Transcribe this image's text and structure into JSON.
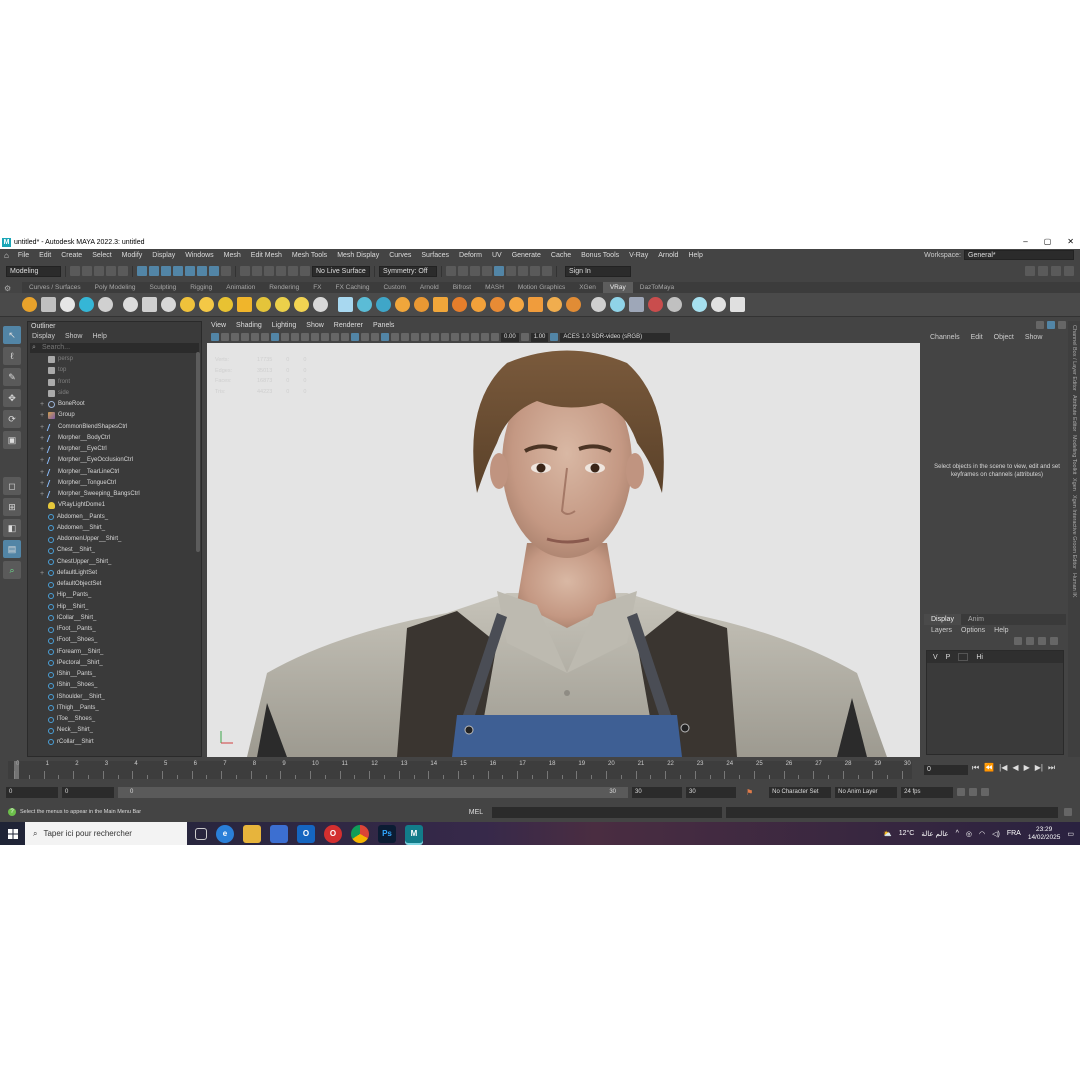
{
  "window": {
    "title": "untitled* - Autodesk MAYA 2022.3: untitled",
    "minimize": "–",
    "maximize": "▢",
    "close": "✕"
  },
  "menubar": {
    "items": [
      "File",
      "Edit",
      "Create",
      "Select",
      "Modify",
      "Display",
      "Windows",
      "Mesh",
      "Edit Mesh",
      "Mesh Tools",
      "Mesh Display",
      "Curves",
      "Surfaces",
      "Deform",
      "UV",
      "Generate",
      "Cache",
      "Bonus Tools",
      "V-Ray",
      "Arnold",
      "Help"
    ],
    "workspace_label": "Workspace:",
    "workspace_value": "General*"
  },
  "statusline": {
    "mode": "Modeling",
    "live_surface": "No Live Surface",
    "symmetry": "Symmetry: Off",
    "sign_in": "Sign In"
  },
  "shelf": {
    "tabs": [
      "Curves / Surfaces",
      "Poly Modeling",
      "Sculpting",
      "Rigging",
      "Animation",
      "Rendering",
      "FX",
      "FX Caching",
      "Custom",
      "Arnold",
      "Bifrost",
      "MASH",
      "Motion Graphics",
      "XGen",
      "VRay",
      "DazToMaya"
    ],
    "active_tab": "VRay",
    "icon_colors": [
      "#e8a22b",
      "#c0c0c0",
      "#e6e6e6",
      "#35b6d6",
      "#d0d0d0",
      "#dcdcdc",
      "#cfcfcf",
      "#d7d7d7",
      "#f0c23b",
      "#f4c846",
      "#e8c232",
      "#f0b52b",
      "#e4c43a",
      "#ebd04a",
      "#f2d352",
      "#d8d8d8",
      "#a8d8f0",
      "#5bbcd6",
      "#3fa6c8",
      "#f0a63b",
      "#e99833",
      "#f0a63a",
      "#e67e2b",
      "#f2a13a",
      "#e88b35",
      "#f4a743",
      "#f09c3c",
      "#f0ad4e",
      "#e18c35",
      "#cfcfcf",
      "#8fd3e8",
      "#9ea7b8",
      "#c94d4d",
      "#c0c0c0",
      "#a6e0ef",
      "#e0e0e0",
      "#e0e0e0"
    ]
  },
  "outliner": {
    "title": "Outliner",
    "menus": [
      "Display",
      "Show",
      "Help"
    ],
    "search_placeholder": "Search...",
    "items": [
      {
        "label": "persp",
        "icon": "cam",
        "exp": "",
        "dim": true
      },
      {
        "label": "top",
        "icon": "cam",
        "exp": "",
        "dim": true
      },
      {
        "label": "front",
        "icon": "cam",
        "exp": "",
        "dim": true
      },
      {
        "label": "side",
        "icon": "cam",
        "exp": "",
        "dim": true
      },
      {
        "label": "BoneRoot",
        "icon": "joint",
        "exp": "+",
        "dim": false
      },
      {
        "label": "Group",
        "icon": "group",
        "exp": "+",
        "dim": false
      },
      {
        "label": "CommonBlendShapesCtrl",
        "icon": "curve",
        "exp": "+",
        "dim": false
      },
      {
        "label": "Morpher__BodyCtrl",
        "icon": "curve",
        "exp": "+",
        "dim": false
      },
      {
        "label": "Morpher__EyeCtrl",
        "icon": "curve",
        "exp": "+",
        "dim": false
      },
      {
        "label": "Morpher__EyeOcclusionCtrl",
        "icon": "curve",
        "exp": "+",
        "dim": false
      },
      {
        "label": "Morpher__TearLineCtrl",
        "icon": "curve",
        "exp": "+",
        "dim": false
      },
      {
        "label": "Morpher__TongueCtrl",
        "icon": "curve",
        "exp": "+",
        "dim": false
      },
      {
        "label": "Morpher_Sweeping_BangsCtrl",
        "icon": "curve",
        "exp": "+",
        "dim": false
      },
      {
        "label": "VRayLightDome1",
        "icon": "light",
        "exp": "",
        "dim": false
      },
      {
        "label": "Abdomen__Pants_",
        "icon": "set",
        "exp": "",
        "dim": false
      },
      {
        "label": "Abdomen__Shirt_",
        "icon": "set",
        "exp": "",
        "dim": false
      },
      {
        "label": "AbdomenUpper__Shirt_",
        "icon": "set",
        "exp": "",
        "dim": false
      },
      {
        "label": "Chest__Shirt_",
        "icon": "set",
        "exp": "",
        "dim": false
      },
      {
        "label": "ChestUpper__Shirt_",
        "icon": "set",
        "exp": "",
        "dim": false
      },
      {
        "label": "defaultLightSet",
        "icon": "set",
        "exp": "+",
        "dim": false
      },
      {
        "label": "defaultObjectSet",
        "icon": "set",
        "exp": "",
        "dim": false
      },
      {
        "label": "Hip__Pants_",
        "icon": "set",
        "exp": "",
        "dim": false
      },
      {
        "label": "Hip__Shirt_",
        "icon": "set",
        "exp": "",
        "dim": false
      },
      {
        "label": "lCollar__Shirt_",
        "icon": "set",
        "exp": "",
        "dim": false
      },
      {
        "label": "lFoot__Pants_",
        "icon": "set",
        "exp": "",
        "dim": false
      },
      {
        "label": "lFoot__Shoes_",
        "icon": "set",
        "exp": "",
        "dim": false
      },
      {
        "label": "lForearm__Shirt_",
        "icon": "set",
        "exp": "",
        "dim": false
      },
      {
        "label": "lPectoral__Shirt_",
        "icon": "set",
        "exp": "",
        "dim": false
      },
      {
        "label": "lShin__Pants_",
        "icon": "set",
        "exp": "",
        "dim": false
      },
      {
        "label": "lShin__Shoes_",
        "icon": "set",
        "exp": "",
        "dim": false
      },
      {
        "label": "lShoulder__Shirt_",
        "icon": "set",
        "exp": "",
        "dim": false
      },
      {
        "label": "lThigh__Pants_",
        "icon": "set",
        "exp": "",
        "dim": false
      },
      {
        "label": "lToe__Shoes_",
        "icon": "set",
        "exp": "",
        "dim": false
      },
      {
        "label": "Neck__Shirt_",
        "icon": "set",
        "exp": "",
        "dim": false
      },
      {
        "label": "rCollar__Shirt",
        "icon": "set",
        "exp": "",
        "dim": false
      }
    ]
  },
  "viewport": {
    "menus": [
      "View",
      "Shading",
      "Lighting",
      "Show",
      "Renderer",
      "Panels"
    ],
    "exposure": "0.00",
    "gamma": "1.00",
    "colorspace": "ACES 1.0 SDR-video (sRGB)",
    "hud": [
      {
        "label": "Verts:",
        "a": "17735",
        "b": "0",
        "c": "0"
      },
      {
        "label": "Edges:",
        "a": "35013",
        "b": "0",
        "c": "0"
      },
      {
        "label": "Faces:",
        "a": "16873",
        "b": "0",
        "c": "0"
      },
      {
        "label": "Tris:",
        "a": "44223",
        "b": "0",
        "c": "0"
      }
    ]
  },
  "channelbox": {
    "menus": [
      "Channels",
      "Edit",
      "Object",
      "Show"
    ],
    "message": "Select objects in the scene to view, edit and set keyframes on channels (attributes)",
    "side_labels": [
      "Channel Box / Layer Editor",
      "Attribute Editor",
      "Modeling Toolkit",
      "Xgen",
      "Xgen Interactive Groom Editor",
      "Human IK"
    ]
  },
  "layers": {
    "tabs": [
      "Display",
      "Anim"
    ],
    "menus": [
      "Layers",
      "Options",
      "Help"
    ],
    "row": {
      "v": "V",
      "p": "P",
      "name": "Hi"
    }
  },
  "timeline": {
    "ticks": [
      "0",
      "1",
      "2",
      "3",
      "4",
      "5",
      "6",
      "7",
      "8",
      "9",
      "10",
      "11",
      "12",
      "13",
      "14",
      "15",
      "16",
      "17",
      "18",
      "19",
      "20",
      "21",
      "22",
      "23",
      "24",
      "25",
      "26",
      "27",
      "28",
      "29",
      "30"
    ],
    "current_frame": "0"
  },
  "range": {
    "start": "0",
    "anim_start": "0",
    "slider_start": "0",
    "slider_end": "30",
    "anim_end": "30",
    "end": "30",
    "character_set": "No Character Set",
    "anim_layer": "No Anim Layer",
    "fps": "24 fps"
  },
  "cmdline": {
    "help": "Select the menus to appear in the Main Menu Bar",
    "mel": "MEL"
  },
  "taskbar": {
    "search": "Taper ici pour rechercher",
    "weather": "12°C",
    "weather_text": "عالم عالة",
    "lang": "FRA",
    "time": "23:29",
    "date": "14/02/2025"
  }
}
